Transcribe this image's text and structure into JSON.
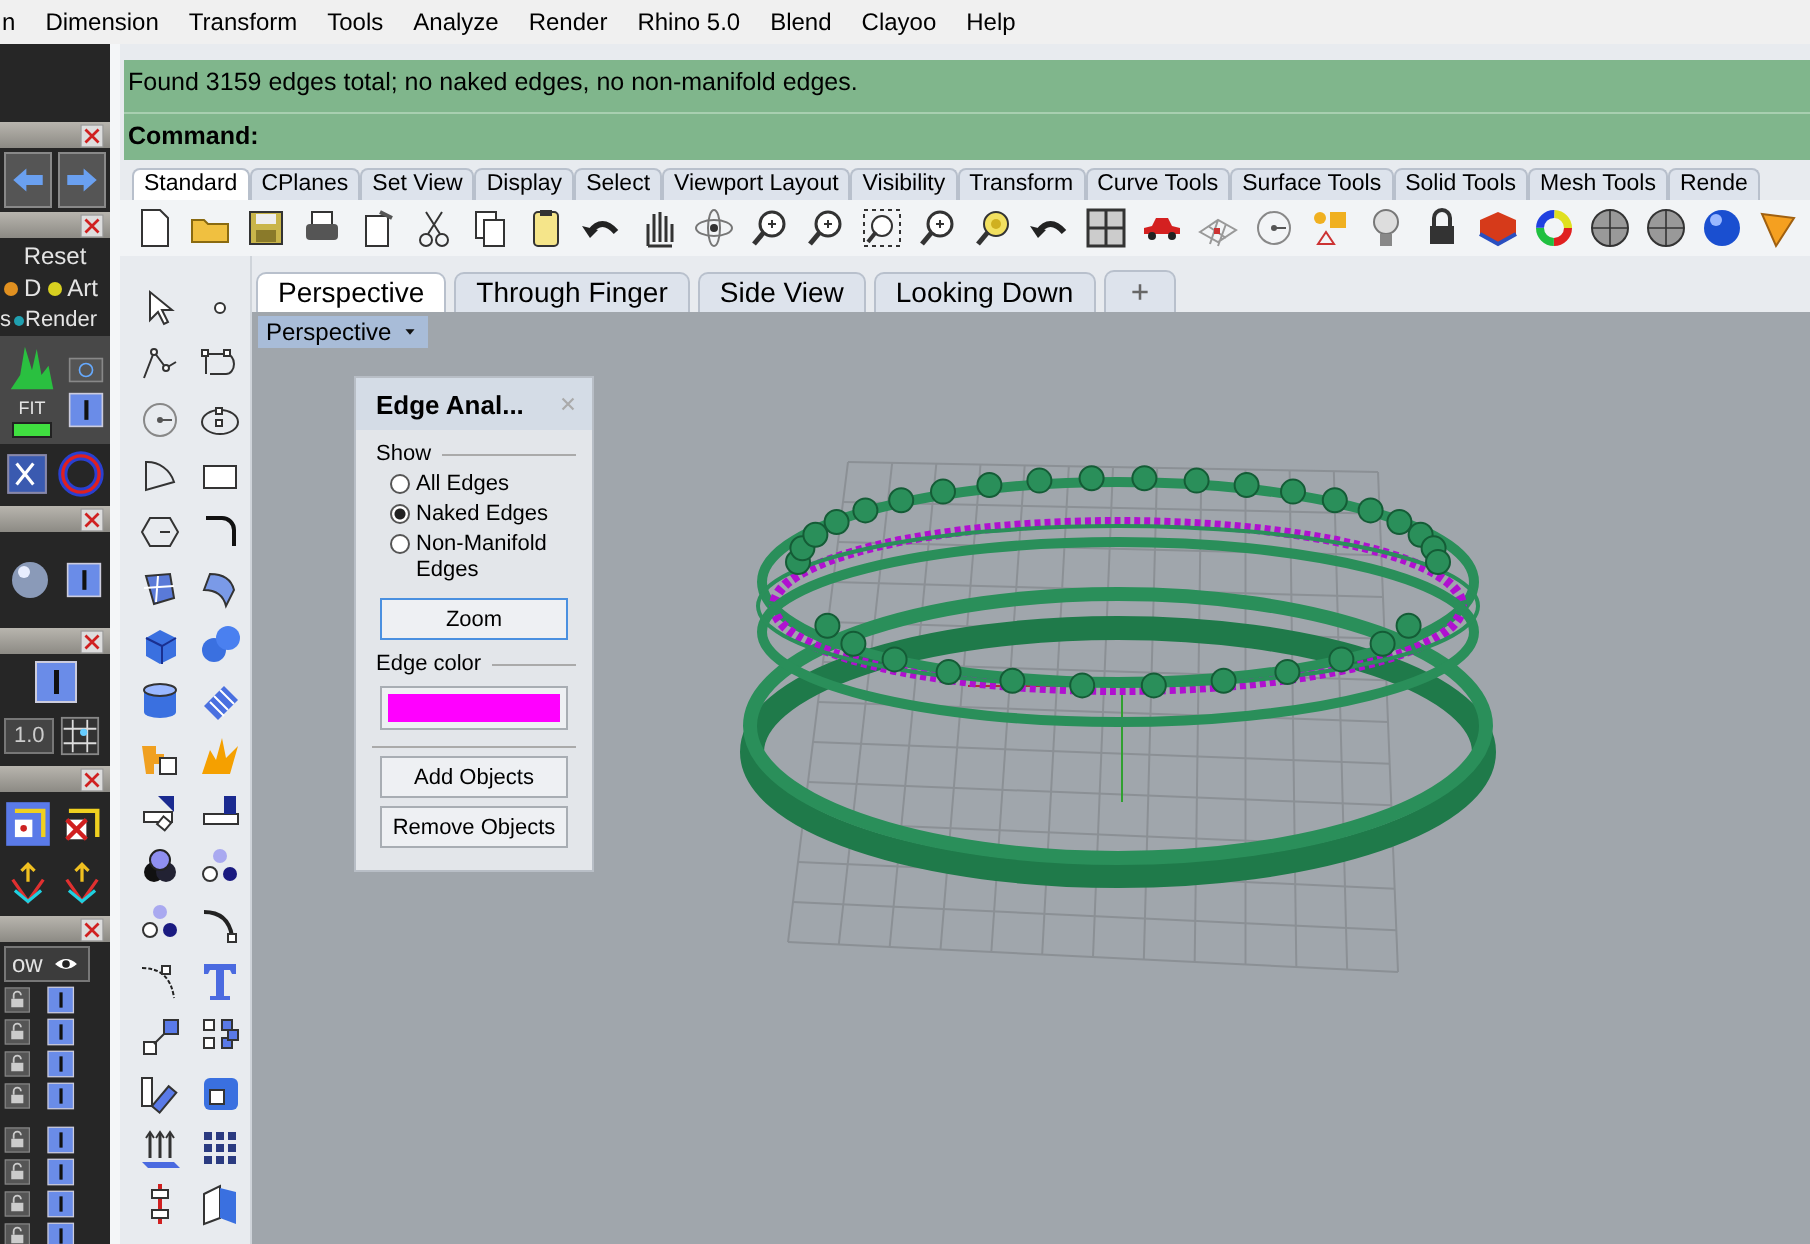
{
  "menu": [
    {
      "label": "n"
    },
    {
      "label": "Dimension"
    },
    {
      "label": "Transform"
    },
    {
      "label": "Tools"
    },
    {
      "label": "Analyze"
    },
    {
      "label": "Render"
    },
    {
      "label": "Rhino 5.0"
    },
    {
      "label": "Blend"
    },
    {
      "label": "Clayoo"
    },
    {
      "label": "Help"
    }
  ],
  "left_panel": {
    "reset": "Reset",
    "display_mode": "D",
    "art_mode": "Art",
    "cut_label": "s",
    "render_mode": "Render",
    "fit": "FIT",
    "scale_value": "1.0",
    "show_label": "ow"
  },
  "command": {
    "history": "Found 3159 edges total; no naked edges, no non-manifold edges.",
    "prompt": "Command:"
  },
  "toolbar_tabs": [
    {
      "label": "Standard",
      "selected": true
    },
    {
      "label": "CPlanes",
      "selected": false
    },
    {
      "label": "Set View",
      "selected": false
    },
    {
      "label": "Display",
      "selected": false
    },
    {
      "label": "Select",
      "selected": false
    },
    {
      "label": "Viewport Layout",
      "selected": false
    },
    {
      "label": "Visibility",
      "selected": false
    },
    {
      "label": "Transform",
      "selected": false
    },
    {
      "label": "Curve Tools",
      "selected": false
    },
    {
      "label": "Surface Tools",
      "selected": false
    },
    {
      "label": "Solid Tools",
      "selected": false
    },
    {
      "label": "Mesh Tools",
      "selected": false
    },
    {
      "label": "Rende",
      "selected": false
    }
  ],
  "viewport_tabs": [
    {
      "label": "Perspective",
      "selected": true
    },
    {
      "label": "Through Finger",
      "selected": false
    },
    {
      "label": "Side View",
      "selected": false
    },
    {
      "label": "Looking Down",
      "selected": false
    }
  ],
  "viewport": {
    "title": "Perspective"
  },
  "edge_analysis": {
    "title": "Edge Anal...",
    "show_label": "Show",
    "options": [
      {
        "label": "All Edges",
        "selected": false
      },
      {
        "label": "Naked Edges",
        "selected": true
      },
      {
        "label": "Non-Manifold Edges",
        "selected": false
      }
    ],
    "zoom_button": "Zoom",
    "edge_color_label": "Edge color",
    "swatch": {
      "color": "#ff00ff"
    },
    "buttons": [
      "Add Objects",
      "Remove Objects"
    ]
  }
}
